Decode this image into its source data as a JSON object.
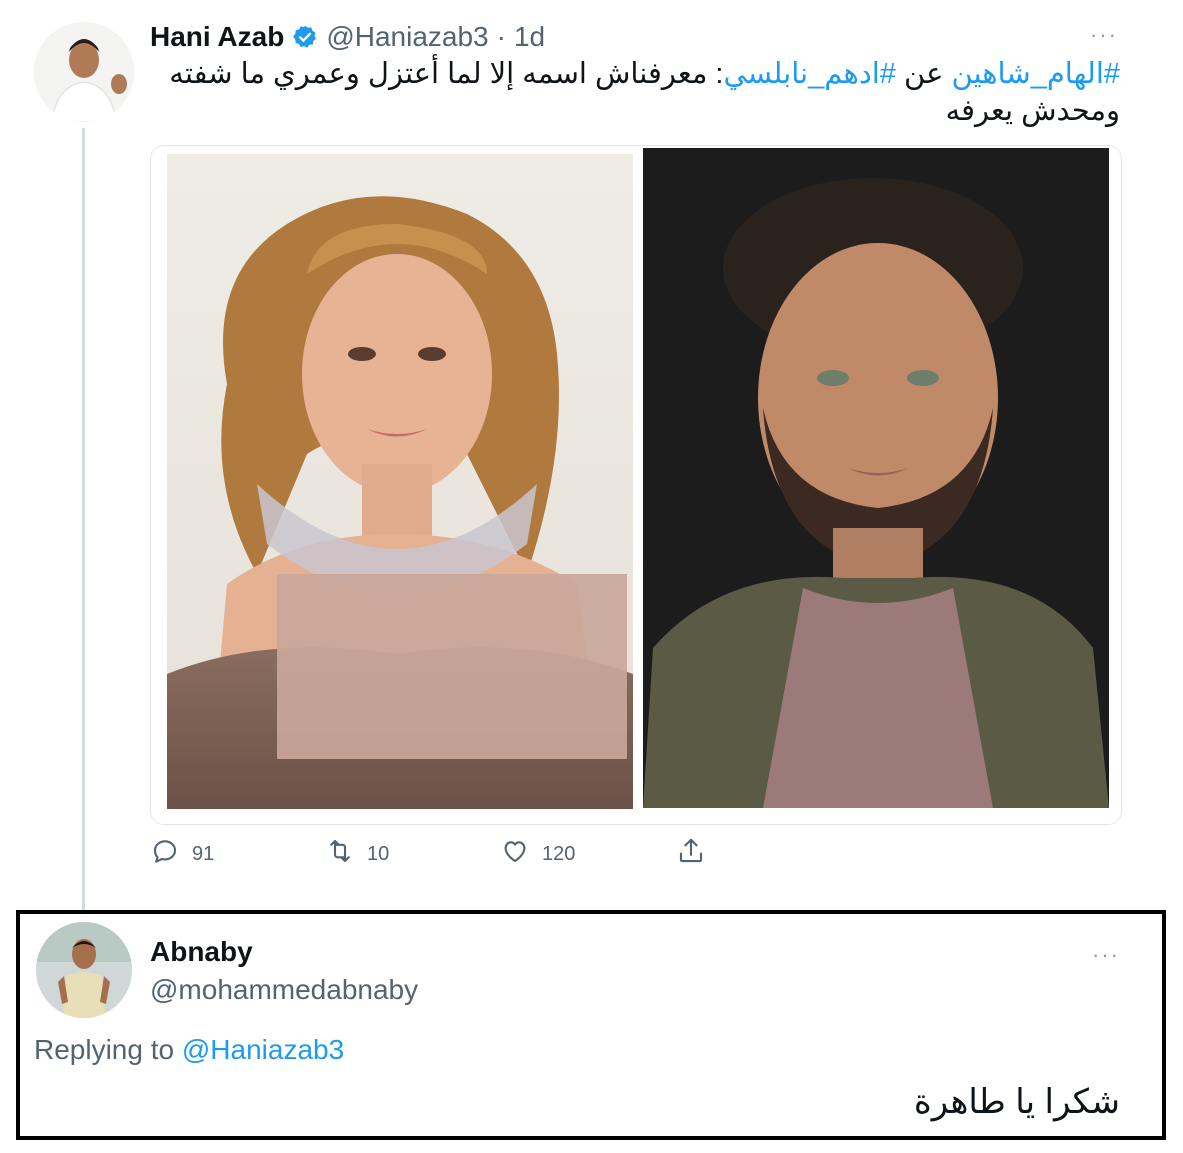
{
  "tweet": {
    "author_name": "Hani Azab",
    "handle": "@Haniazab3",
    "separator": "·",
    "time": "1d",
    "more_label": "···",
    "text_line1": {
      "hashtag1": "#الهام_شاهين",
      "word": " عن ",
      "hashtag2": "#ادهم_نابلسي",
      "rest": ": معرفناش اسمه إلا لما أعتزل وعمري ما شفته"
    },
    "text_line2": "ومحدش يعرفه",
    "actions": {
      "reply_count": "91",
      "retweet_count": "10",
      "like_count": "120"
    }
  },
  "reply": {
    "author_name": "Abnaby",
    "handle": "@mohammedabnaby",
    "more_label": "···",
    "replying_prefix": "Replying to",
    "replying_handle": "@Haniazab3",
    "text": "شكرا يا طاهرة"
  },
  "icons": {
    "verified": "verified-badge-icon",
    "reply": "reply-icon",
    "retweet": "retweet-icon",
    "like": "heart-icon",
    "share": "share-icon"
  },
  "colors": {
    "link": "#1d9bf0",
    "muted": "#536471",
    "thread_line": "#cfd9de"
  }
}
